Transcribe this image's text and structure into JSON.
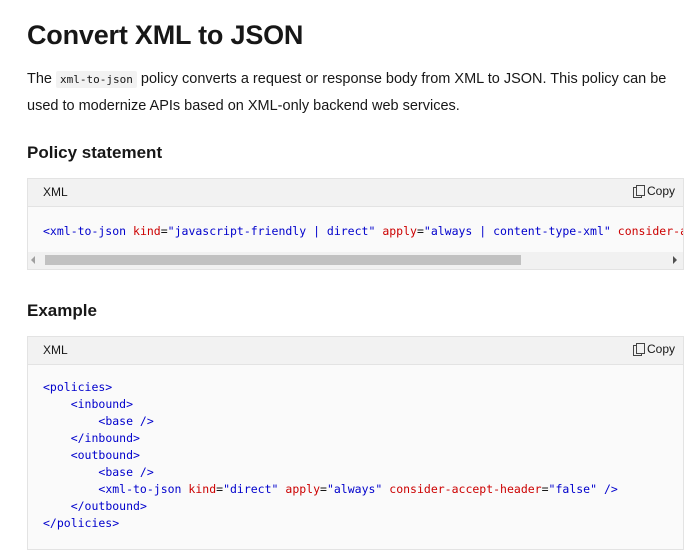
{
  "title": "Convert XML to JSON",
  "intro": {
    "before_code": "The ",
    "code": "xml-to-json",
    "after_code": " policy converts a request or response body from XML to JSON. This policy can be used to modernize APIs based on XML-only backend web services."
  },
  "section_policy": {
    "heading": "Policy statement",
    "lang": "XML",
    "copy_label": "Copy",
    "code": {
      "tag_open": "<xml-to-json",
      "attr1": "kind",
      "val1": "\"javascript-friendly | direct\"",
      "attr2": "apply",
      "val2": "\"always | content-type-xml\"",
      "attr3": "consider-a"
    }
  },
  "section_example": {
    "heading": "Example",
    "lang": "XML",
    "copy_label": "Copy",
    "lines": {
      "l1": "<policies>",
      "l2": "<inbound>",
      "l3": "<base />",
      "l4": "</inbound>",
      "l5": "<outbound>",
      "l6": "<base />",
      "l7_tag": "<xml-to-json",
      "l7_attr1": "kind",
      "l7_val1": "\"direct\"",
      "l7_attr2": "apply",
      "l7_val2": "\"always\"",
      "l7_attr3": "consider-accept-header",
      "l7_val3": "\"false\"",
      "l7_close": "/>",
      "l8": "</outbound>",
      "l9": "</policies>"
    }
  },
  "colors": {
    "tag": "#0000cc",
    "attribute": "#cc0000",
    "string": "#a31515"
  }
}
